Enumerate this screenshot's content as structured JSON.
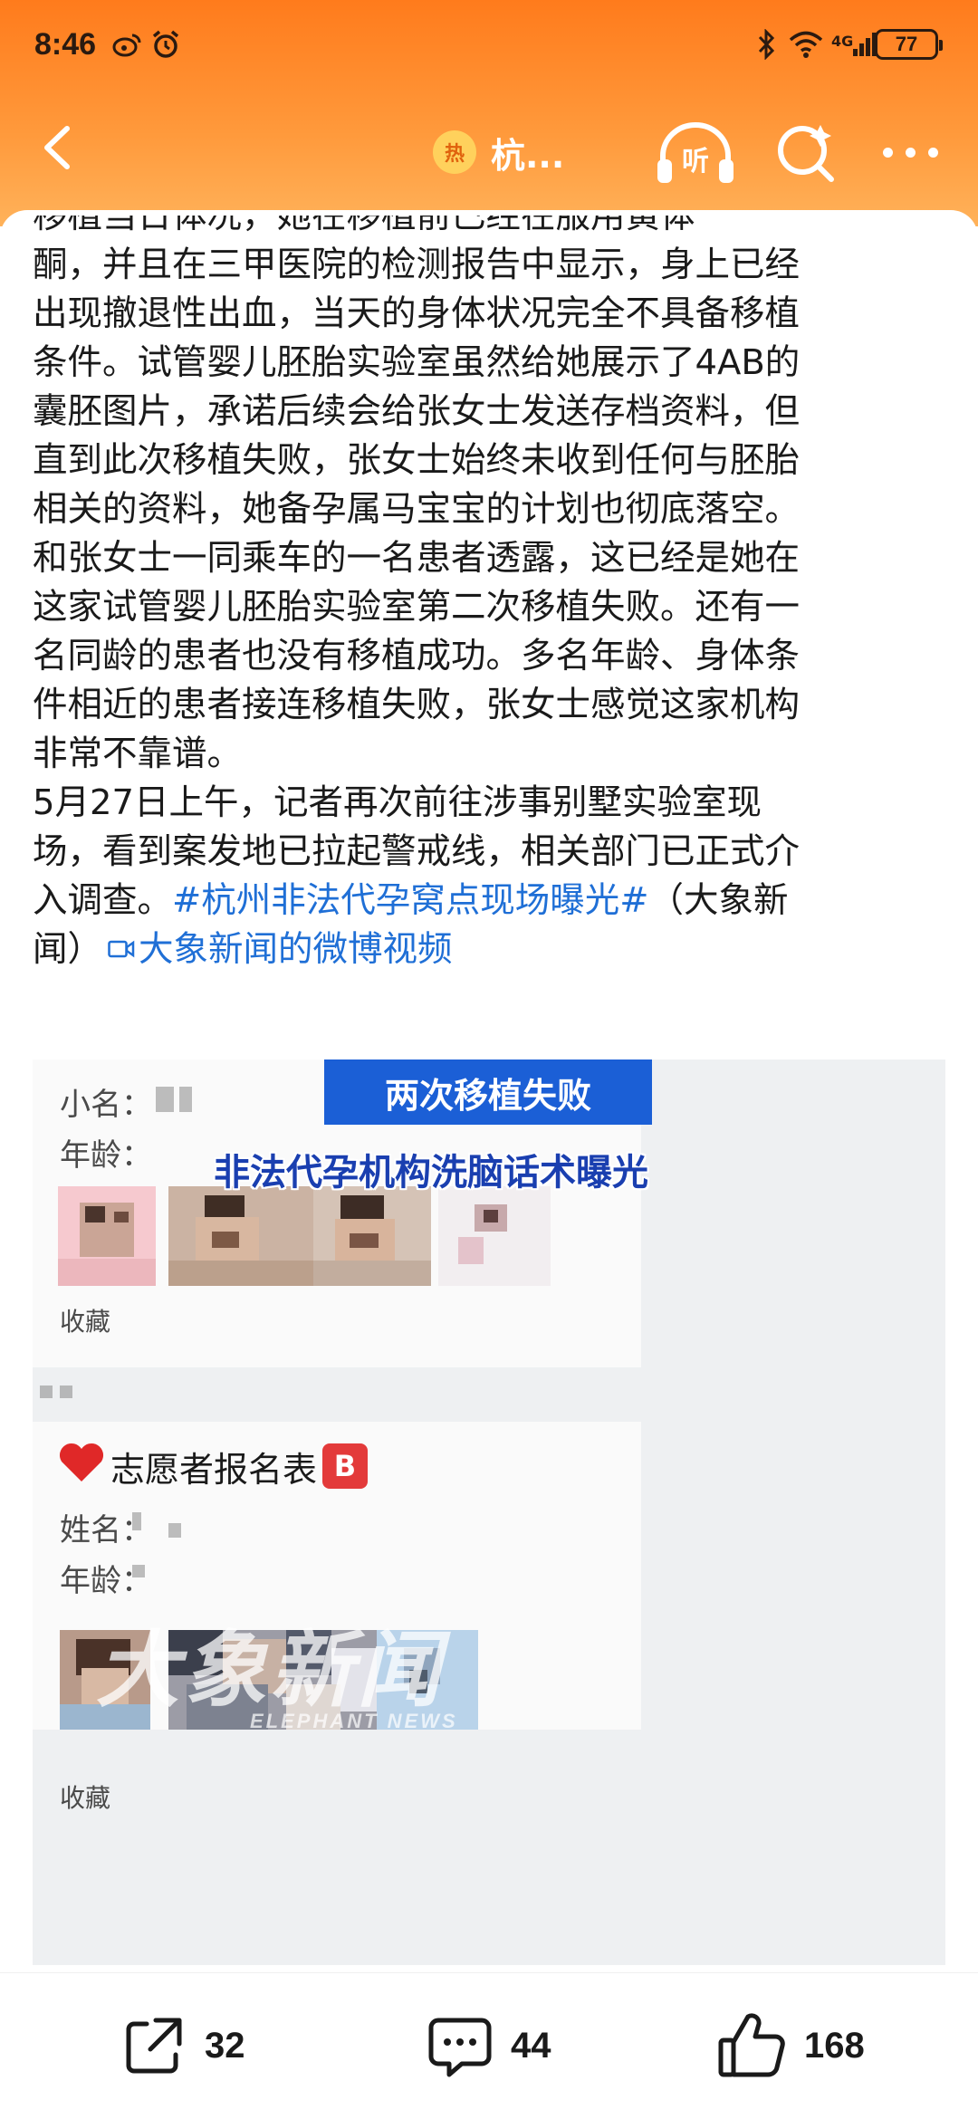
{
  "status_bar": {
    "time": "8:46",
    "network": "4G",
    "battery": "77"
  },
  "nav": {
    "hot_badge": "热",
    "title": "杭...",
    "listen_label": "听"
  },
  "article": {
    "lines": [
      "酮，并且在三甲医院的检测报告中显示，身上已经",
      "出现撤退性出血，当天的身体状况完全不具备移植",
      "条件。试管婴儿胚胎实验室虽然给她展示了4AB的",
      "囊胚图片，承诺后续会给张女士发送存档资料，但",
      "直到此次移植失败，张女士始终未收到任何与胚胎",
      "相关的资料，她备孕属马宝宝的计划也彻底落空。",
      "和张女士一同乘车的一名患者透露，这已经是她在",
      "这家试管婴儿胚胎实验室第二次移植失败。还有一",
      "名同龄的患者也没有移植成功。多名年龄、身体条",
      "件相近的患者接连移植失败，张女士感觉这家机构",
      "非常不靠谱。",
      "5月27日上午，记者再次前往涉事别墅实验室现",
      "场，看到案发地已拉起警戒线，相关部门已正式介"
    ],
    "last_line_prefix": "入调查。",
    "hashtag": "#杭州非法代孕窝点现场曝光#",
    "last_line_suffix": "（大象新",
    "final_line_prefix": "闻）",
    "video_link": "大象新闻的微博视频"
  },
  "embed": {
    "banner_top": "两次移植失败",
    "banner_main": "非法代孕机构洗脑话术曝光",
    "card1": {
      "name_label": "小名：",
      "age_label": "年龄：",
      "collect": "收藏"
    },
    "card2": {
      "title": "志愿者报名表",
      "badge": "B",
      "name_label": "姓名：",
      "age_label": "年龄：",
      "collect": "收藏"
    },
    "watermark": "大象新闻",
    "watermark_sub": "ELEPHANT NEWS"
  },
  "actions": {
    "share_count": "32",
    "comment_count": "44",
    "like_count": "168"
  }
}
